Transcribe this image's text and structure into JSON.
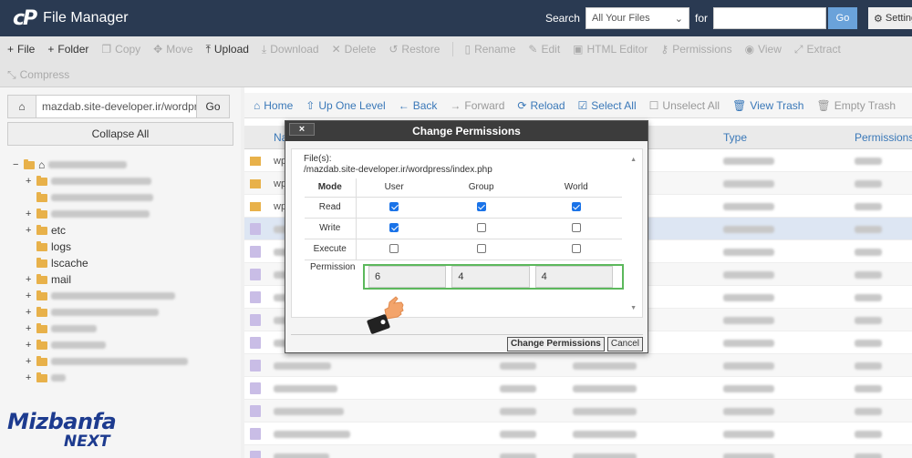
{
  "header": {
    "app_title": "File Manager",
    "search_label": "Search",
    "search_scope": "All Your Files",
    "for_label": "for",
    "go_label": "Go",
    "settings_label": "Settings"
  },
  "toolbar": {
    "row1": [
      {
        "label": "File",
        "icon": "+",
        "enabled": true
      },
      {
        "label": "Folder",
        "icon": "+",
        "enabled": true
      },
      {
        "label": "Copy",
        "icon": "❐",
        "enabled": false
      },
      {
        "label": "Move",
        "icon": "✥",
        "enabled": false
      },
      {
        "label": "Upload",
        "icon": "⤒",
        "enabled": true
      },
      {
        "label": "Download",
        "icon": "⤓",
        "enabled": false
      },
      {
        "label": "Delete",
        "icon": "✕",
        "enabled": false
      },
      {
        "label": "Restore",
        "icon": "↺",
        "enabled": false
      },
      {
        "label": "Rename",
        "icon": "▯",
        "enabled": false
      },
      {
        "label": "Edit",
        "icon": "✎",
        "enabled": false
      },
      {
        "label": "HTML Editor",
        "icon": "▣",
        "enabled": false
      },
      {
        "label": "Permissions",
        "icon": "⚷",
        "enabled": false
      },
      {
        "label": "View",
        "icon": "◉",
        "enabled": false
      },
      {
        "label": "Extract",
        "icon": "⤢",
        "enabled": false
      }
    ],
    "compress": {
      "label": "Compress",
      "icon": "⤡"
    }
  },
  "left": {
    "path_value": "mazdab.site-developer.ir/wordpress",
    "go_label": "Go",
    "collapse_label": "Collapse All",
    "tree": [
      {
        "label": "etc"
      },
      {
        "label": "logs"
      },
      {
        "label": "lscache"
      },
      {
        "label": "mail"
      }
    ]
  },
  "nav": {
    "items": [
      {
        "label": "Home",
        "icon": "⌂",
        "dim": false
      },
      {
        "label": "Up One Level",
        "icon": "⇧",
        "dim": false
      },
      {
        "label": "Back",
        "icon": "←",
        "dim": false
      },
      {
        "label": "Forward",
        "icon": "→",
        "dim": true
      },
      {
        "label": "Reload",
        "icon": "⟳",
        "dim": false
      },
      {
        "label": "Select All",
        "icon": "☑",
        "dim": false
      },
      {
        "label": "Unselect All",
        "icon": "☐",
        "dim": true
      },
      {
        "label": "View Trash",
        "icon": "🗑",
        "dim": false
      },
      {
        "label": "Empty Trash",
        "icon": "🗑",
        "dim": true
      }
    ]
  },
  "file_table": {
    "col_name": "Na",
    "col_type": "Type",
    "col_perms": "Permissions",
    "visible_names": [
      "wp",
      "wp",
      "wp"
    ]
  },
  "dialog": {
    "title": "Change Permissions",
    "close_label": "×",
    "files_label": "File(s):",
    "file_path": "/mazdab.site-developer.ir/wordpress/index.php",
    "headers": {
      "mode": "Mode",
      "user": "User",
      "group": "Group",
      "world": "World"
    },
    "rows": [
      {
        "mode": "Read",
        "user": true,
        "group": true,
        "world": true
      },
      {
        "mode": "Write",
        "user": true,
        "group": false,
        "world": false
      },
      {
        "mode": "Execute",
        "user": false,
        "group": false,
        "world": false
      }
    ],
    "permission_label": "Permission",
    "permission_values": [
      "6",
      "4",
      "4"
    ],
    "ok_label": "Change Permissions",
    "cancel_label": "Cancel"
  },
  "watermark": {
    "top": "Mizbanfa",
    "bottom": "NEXT"
  },
  "colors": {
    "header_bg": "#2a3a52",
    "accent": "#3a78b8",
    "highlight_green": "#5cb85c",
    "checkbox_blue": "#1a73e8"
  }
}
